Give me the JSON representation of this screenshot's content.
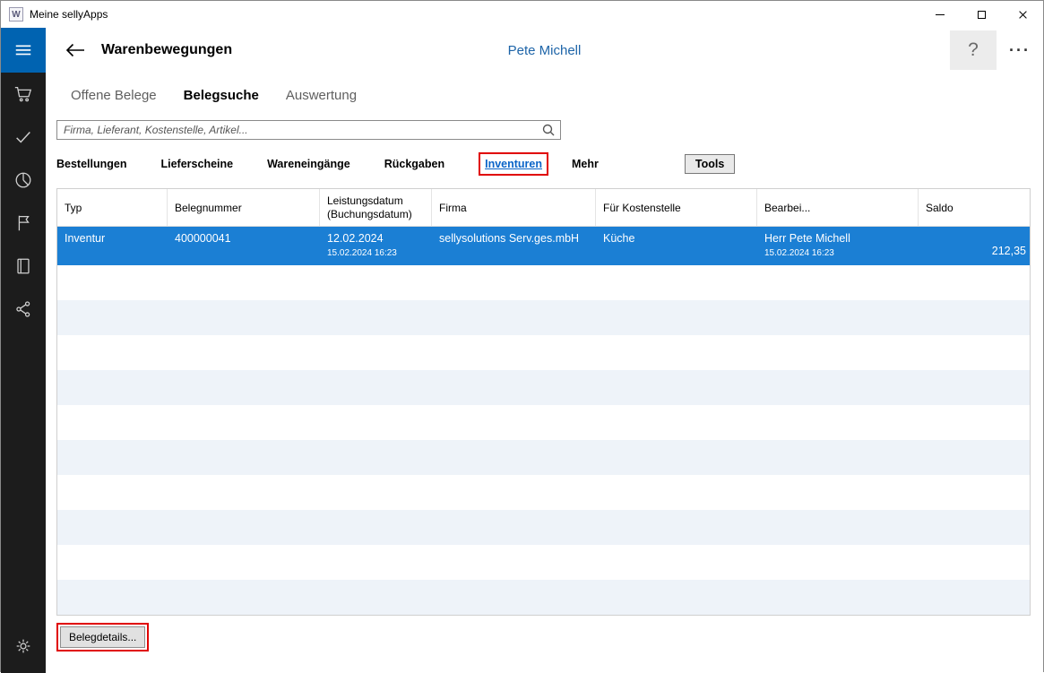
{
  "window": {
    "title": "Meine sellyApps",
    "icon_letter": "W",
    "controls": [
      {
        "name": "minimize-button"
      },
      {
        "name": "maximize-button"
      },
      {
        "name": "close-button"
      }
    ]
  },
  "sidebar": {
    "items": [
      {
        "name": "menu-icon"
      },
      {
        "name": "cart-icon"
      },
      {
        "name": "check-icon"
      },
      {
        "name": "pie-chart-icon"
      },
      {
        "name": "flag-icon"
      },
      {
        "name": "journal-icon"
      },
      {
        "name": "share-icon"
      },
      {
        "name": "settings-gear-icon"
      }
    ]
  },
  "header": {
    "title": "Warenbewegungen",
    "user": "Pete Michell",
    "help_label": "?",
    "more_label": "···"
  },
  "tabs": [
    {
      "label": "Offene Belege",
      "active": false
    },
    {
      "label": "Belegsuche",
      "active": true
    },
    {
      "label": "Auswertung",
      "active": false
    }
  ],
  "search": {
    "placeholder": "Firma, Lieferant, Kostenstelle, Artikel..."
  },
  "filters": {
    "items": [
      {
        "label": "Bestellungen",
        "selected": false
      },
      {
        "label": "Lieferscheine",
        "selected": false
      },
      {
        "label": "Wareneingänge",
        "selected": false
      },
      {
        "label": "Rückgaben",
        "selected": false
      },
      {
        "label": "Inventuren",
        "selected": true,
        "highlighted": true
      },
      {
        "label": "Mehr",
        "selected": false
      }
    ],
    "tools_label": "Tools"
  },
  "table": {
    "columns": [
      {
        "label": "Typ"
      },
      {
        "label": "Belegnummer"
      },
      {
        "label": "Leistungsdatum",
        "sublabel": "(Buchungsdatum)"
      },
      {
        "label": "Firma"
      },
      {
        "label": "Für Kostenstelle"
      },
      {
        "label": "Bearbei..."
      },
      {
        "label": "Saldo"
      }
    ],
    "rows": [
      {
        "typ": "Inventur",
        "belegnummer": "400000041",
        "leistungsdatum": "12.02.2024",
        "buchungsdatum": "15.02.2024 16:23",
        "firma": "sellysolutions Serv.ges.mbH",
        "fuer_kostenstelle": "Küche",
        "bearbeiter": "Herr Pete Michell",
        "bearbeitet_am": "15.02.2024 16:23",
        "saldo": "212,35",
        "selected": true
      }
    ]
  },
  "footer": {
    "details_button_label": "Belegdetails..."
  },
  "colors": {
    "accent_blue": "#1b7fd4",
    "selected_row": "#1b7fd4",
    "link_blue": "#0a64c8",
    "user_name_blue": "#1d64a8",
    "sidebar_bg": "#1c1c1c",
    "menu_block_bg": "#0063b1",
    "annotation_red": "#e00000",
    "row_stripe": "#eef3f9"
  }
}
